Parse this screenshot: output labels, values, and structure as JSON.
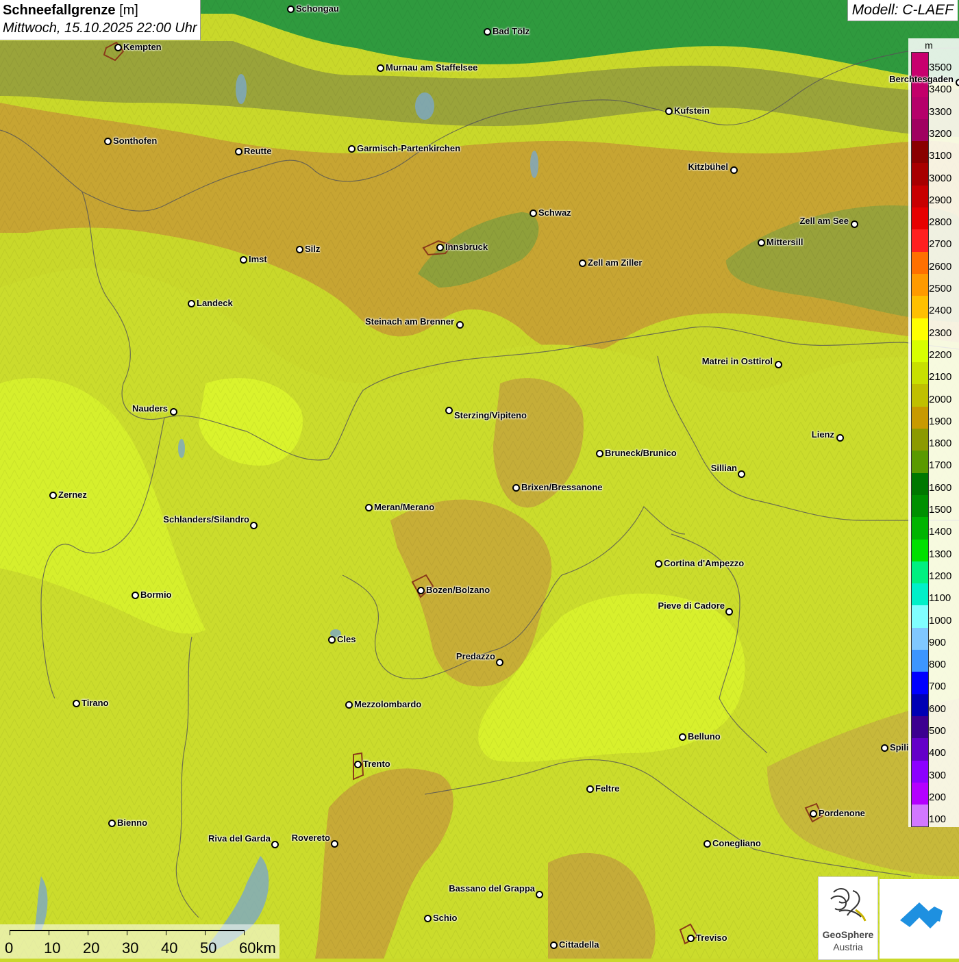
{
  "header": {
    "title_bold": "Schneefallgrenze",
    "title_unit": " [m]",
    "datetime": "Mittwoch, 15.10.2025 22:00 Uhr",
    "model": "Modell: C-LAEF"
  },
  "legend": {
    "unit": "m",
    "levels": [
      {
        "label": "3500",
        "color": "#c8006e"
      },
      {
        "label": "3400",
        "color": "#c3006a"
      },
      {
        "label": "3300",
        "color": "#b5006a"
      },
      {
        "label": "3200",
        "color": "#a00060"
      },
      {
        "label": "3100",
        "color": "#8a0000"
      },
      {
        "label": "3000",
        "color": "#a80000"
      },
      {
        "label": "2900",
        "color": "#c80000"
      },
      {
        "label": "2800",
        "color": "#e60000"
      },
      {
        "label": "2700",
        "color": "#ff2020"
      },
      {
        "label": "2600",
        "color": "#ff7000"
      },
      {
        "label": "2500",
        "color": "#ff9a00"
      },
      {
        "label": "2400",
        "color": "#ffc000"
      },
      {
        "label": "2300",
        "color": "#ffff00"
      },
      {
        "label": "2200",
        "color": "#d8ff00"
      },
      {
        "label": "2100",
        "color": "#c8e000"
      },
      {
        "label": "2000",
        "color": "#c0c000"
      },
      {
        "label": "1900",
        "color": "#c89a00"
      },
      {
        "label": "1800",
        "color": "#8c9a00"
      },
      {
        "label": "1700",
        "color": "#5a9a00"
      },
      {
        "label": "1600",
        "color": "#007800"
      },
      {
        "label": "1500",
        "color": "#009000"
      },
      {
        "label": "1400",
        "color": "#00b400"
      },
      {
        "label": "1300",
        "color": "#00e000"
      },
      {
        "label": "1200",
        "color": "#00f080"
      },
      {
        "label": "1100",
        "color": "#00f0c8"
      },
      {
        "label": "1000",
        "color": "#80ffff"
      },
      {
        "label": "900",
        "color": "#80c8ff"
      },
      {
        "label": "800",
        "color": "#3c96ff"
      },
      {
        "label": "700",
        "color": "#0000ff"
      },
      {
        "label": "600",
        "color": "#0000b4"
      },
      {
        "label": "500",
        "color": "#3c0090"
      },
      {
        "label": "400",
        "color": "#6400c8"
      },
      {
        "label": "300",
        "color": "#8c00ff"
      },
      {
        "label": "200",
        "color": "#b400ff"
      },
      {
        "label": "100",
        "color": "#d278ff"
      }
    ]
  },
  "cities": [
    {
      "name": "Schongau"
    },
    {
      "name": "Bad Tölz"
    },
    {
      "name": "Kempten"
    },
    {
      "name": "Murnau am Staffelsee"
    },
    {
      "name": "Berchtesgaden"
    },
    {
      "name": "Kufstein"
    },
    {
      "name": "Sonthofen"
    },
    {
      "name": "Reutte"
    },
    {
      "name": "Garmisch-Partenkirchen"
    },
    {
      "name": "Kitzbühel"
    },
    {
      "name": "Schwaz"
    },
    {
      "name": "Zell am See"
    },
    {
      "name": "Innsbruck"
    },
    {
      "name": "Mittersill"
    },
    {
      "name": "Imst"
    },
    {
      "name": "Silz"
    },
    {
      "name": "Zell am Ziller"
    },
    {
      "name": "Landeck"
    },
    {
      "name": "Steinach am Brenner"
    },
    {
      "name": "Matrei in Osttirol"
    },
    {
      "name": "Nauders"
    },
    {
      "name": "Sterzing/Vipiteno"
    },
    {
      "name": "Lienz"
    },
    {
      "name": "Bruneck/Brunico"
    },
    {
      "name": "Sillian"
    },
    {
      "name": "Brixen/Bressanone"
    },
    {
      "name": "Zernez"
    },
    {
      "name": "Meran/Merano"
    },
    {
      "name": "Schlanders/Silandro"
    },
    {
      "name": "Cortina d'Ampezzo"
    },
    {
      "name": "Bormio"
    },
    {
      "name": "Bozen/Bolzano"
    },
    {
      "name": "Pieve di Cadore"
    },
    {
      "name": "Cles"
    },
    {
      "name": "Predazzo"
    },
    {
      "name": "Tirano"
    },
    {
      "name": "Mezzolombardo"
    },
    {
      "name": "Belluno"
    },
    {
      "name": "Spili"
    },
    {
      "name": "Trento"
    },
    {
      "name": "Feltre"
    },
    {
      "name": "Pordenone"
    },
    {
      "name": "Bienno"
    },
    {
      "name": "Riva del Garda"
    },
    {
      "name": "Rovereto"
    },
    {
      "name": "Conegliano"
    },
    {
      "name": "Bassano del Grappa"
    },
    {
      "name": "Schio"
    },
    {
      "name": "Treviso"
    },
    {
      "name": "Cittadella"
    }
  ],
  "scalebar": {
    "labels": [
      "0",
      "10",
      "20",
      "30",
      "40",
      "50",
      "60km"
    ]
  },
  "logos": {
    "geosphere_line1": "GeoSphere",
    "geosphere_line2": "Austria"
  },
  "colors": {
    "base": "#c9d82a",
    "yellow_green": "#d4ec2a",
    "bright": "#dcf52e",
    "orange_brown": "#c8a830",
    "olive": "#a8aa3a",
    "green_north": "#3a9a3a",
    "dark_green": "#2a8a3a"
  }
}
